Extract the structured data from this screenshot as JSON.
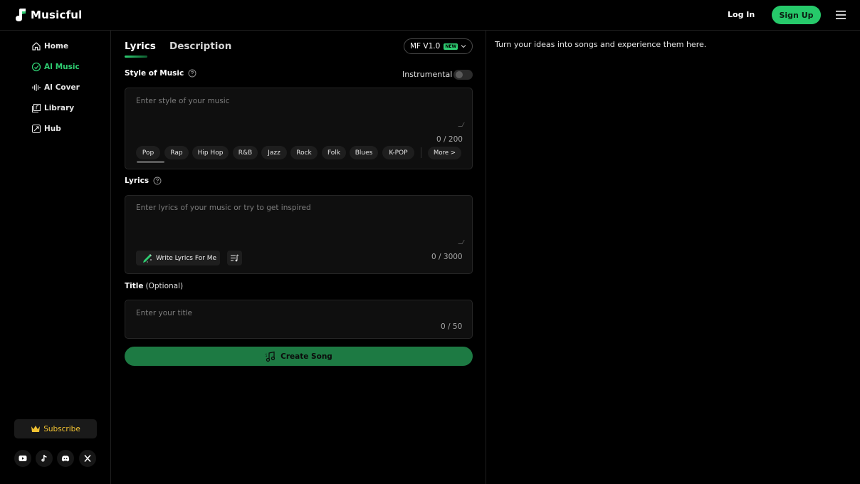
{
  "header": {
    "brand": "Musicful",
    "login_label": "Log In",
    "signup_label": "Sign Up",
    "accent_color": "#26c96a"
  },
  "sidebar": {
    "items": [
      {
        "label": "Home",
        "icon": "home-icon",
        "active": false
      },
      {
        "label": "AI Music",
        "icon": "ai-music-icon",
        "active": true
      },
      {
        "label": "AI Cover",
        "icon": "waveform-icon",
        "active": false
      },
      {
        "label": "Library",
        "icon": "library-icon",
        "active": false
      },
      {
        "label": "Hub",
        "icon": "hub-icon",
        "active": false
      }
    ],
    "subscribe_label": "Subscribe",
    "social": [
      "youtube-icon",
      "tiktok-icon",
      "discord-icon",
      "x-icon"
    ]
  },
  "main": {
    "tabs": [
      {
        "label": "Lyrics",
        "active": true
      },
      {
        "label": "Description",
        "active": false
      }
    ],
    "model": {
      "label": "MF V1.0",
      "badge": "NEW"
    },
    "style": {
      "label": "Style of Music",
      "instrumental_label": "Instrumental",
      "instrumental_on": false,
      "placeholder": "Enter style of your music",
      "counter": "0 / 200",
      "genres": [
        "Pop",
        "Rap",
        "Hip Hop",
        "R&B",
        "Jazz",
        "Rock",
        "Folk",
        "Blues",
        "K-POP"
      ],
      "more_label": "More >"
    },
    "lyrics": {
      "label": "Lyrics",
      "placeholder": "Enter lyrics of your music or try to get inspired",
      "write_label": "Write Lyrics For Me",
      "counter": "0 / 3000"
    },
    "title": {
      "label": "Title",
      "optional": "(Optional)",
      "placeholder": "Enter your title",
      "counter": "0 / 50"
    },
    "create_label": "Create Song"
  },
  "right": {
    "tagline": "Turn your ideas into songs and experience them here."
  }
}
